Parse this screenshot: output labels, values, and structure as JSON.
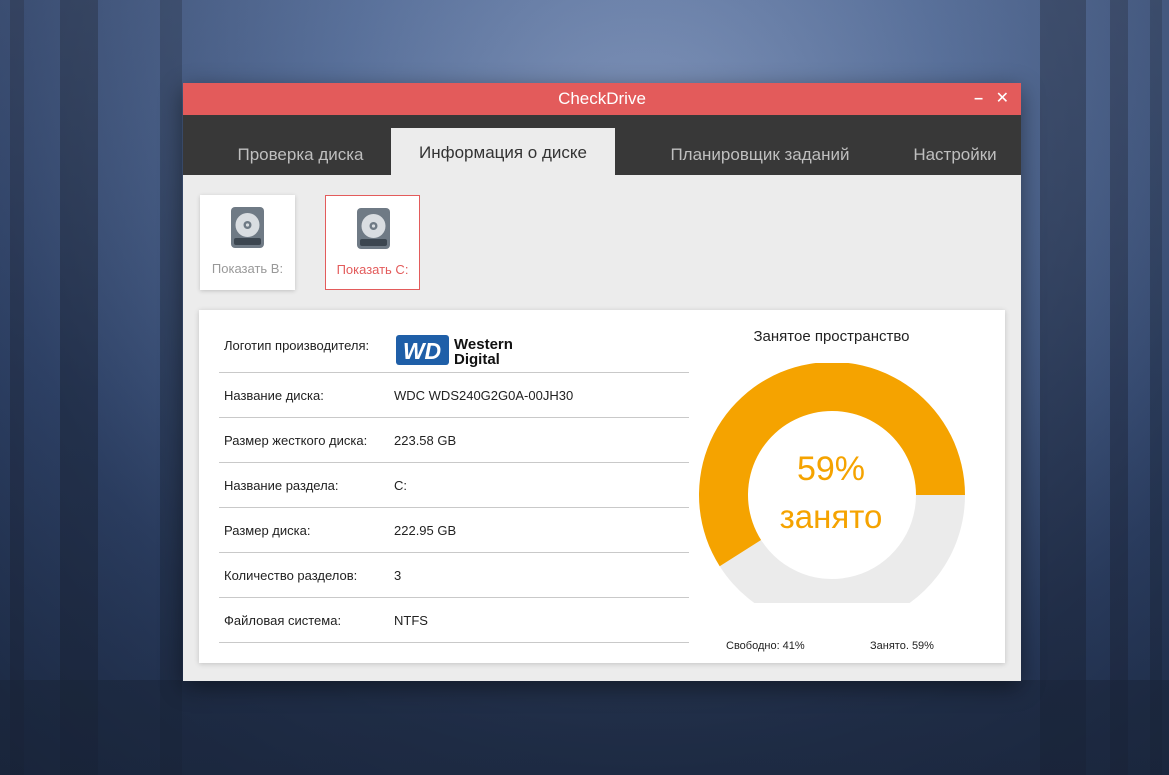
{
  "window": {
    "title": "CheckDrive",
    "minimize": "–",
    "close": "✕"
  },
  "tabs": [
    {
      "label": "Проверка диска"
    },
    {
      "label": "Информация о диске"
    },
    {
      "label": "Планировщик заданий"
    },
    {
      "label": "Настройки"
    }
  ],
  "drives": [
    {
      "label": "Показать B:",
      "icon": "hard-drive-icon"
    },
    {
      "label": "Показать C:",
      "icon": "hard-drive-icon"
    }
  ],
  "info": {
    "logo_label": "Логотип производителя:",
    "logo_text_1": "Western",
    "logo_text_2": "Digital",
    "logo_mark": "WD",
    "rows": [
      {
        "label": "Название диска:",
        "value": "WDC WDS240G2G0A-00JH30"
      },
      {
        "label": "Размер жесткого диска:",
        "value": "223.58 GB"
      },
      {
        "label": "Название раздела:",
        "value": "C:"
      },
      {
        "label": "Размер диска:",
        "value": "222.95 GB"
      },
      {
        "label": "Количество разделов:",
        "value": "3"
      },
      {
        "label": "Файловая система:",
        "value": "NTFS"
      }
    ]
  },
  "usage": {
    "title": "Занятое пространство",
    "percent_text": "59%",
    "caption": "занято",
    "used_fraction": 0.59,
    "free_label": "Свободно: 41%",
    "used_label": "Занято. 59%",
    "used_color": "#f5a300",
    "free_color": "#ebebeb"
  },
  "colors": {
    "accent": "#e35b5b",
    "tabbar": "#383838"
  }
}
